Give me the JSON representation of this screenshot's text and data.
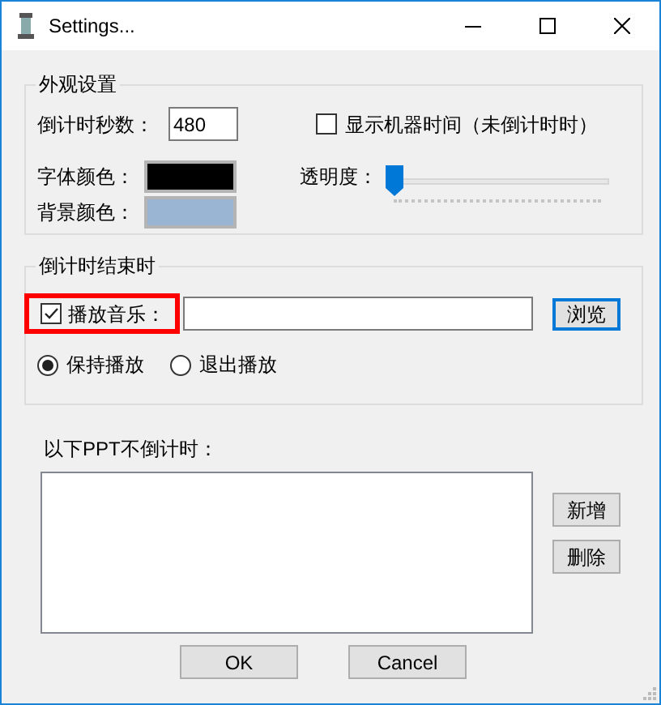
{
  "window": {
    "title": "Settings..."
  },
  "appearance": {
    "title": "外观设置",
    "countdown_label": "倒计时秒数：",
    "countdown_value": "480",
    "show_clock": {
      "label": "显示机器时间（未倒计时时）",
      "checked": false
    },
    "font_color": {
      "label": "字体颜色：",
      "color": "#000000"
    },
    "opacity": {
      "label": "透明度：",
      "level": 0
    },
    "background_color": {
      "label": "背景颜色：",
      "color": "#9ab4d4"
    }
  },
  "on_end": {
    "title": "倒计时结束时",
    "play_music": {
      "label": "播放音乐：",
      "checked": true,
      "highlighted": true
    },
    "browse_button": {
      "label": "浏览",
      "focused": true
    },
    "options": [
      {
        "label": "保持播放",
        "selected": true
      },
      {
        "label": "退出播放",
        "selected": false
      }
    ]
  },
  "exclusions": {
    "label": "以下PPT不倒计时：",
    "buttons": [
      "新增",
      "删除"
    ]
  },
  "buttons": [
    "OK",
    "Cancel"
  ]
}
